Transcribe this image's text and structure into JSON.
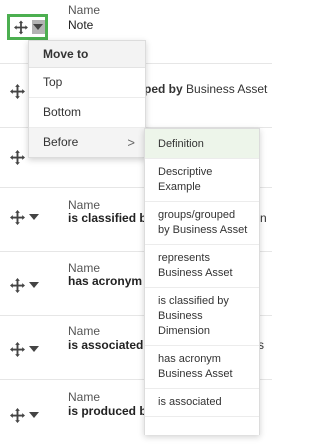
{
  "rows": [
    {
      "label": "Name",
      "value": "Note",
      "tail_plain": "",
      "tail_bold": ""
    },
    {
      "label": "",
      "value": "",
      "tail_pre": "ped by",
      "tail_post": "Business Asset"
    },
    {
      "label": "",
      "value": "",
      "tail": ""
    },
    {
      "label": "Name",
      "value": "is classified b",
      "tail": "n"
    },
    {
      "label": "Name",
      "value": "has acronym",
      "tail": ""
    },
    {
      "label": "Name",
      "value": "is associated",
      "tail": "s"
    },
    {
      "label": "Name",
      "value": "is produced b",
      "tail": ""
    }
  ],
  "menu": {
    "header": "Move to",
    "items": [
      {
        "label": "Top"
      },
      {
        "label": "Bottom"
      },
      {
        "label": "Before",
        "chevron": ">"
      }
    ]
  },
  "submenu": {
    "items": [
      "Definition",
      "Descriptive Example",
      "groups/grouped by Business Asset",
      "represents Business Asset",
      "is classified by Business Dimension",
      "has acronym Business Asset",
      "is associated"
    ]
  },
  "colors": {
    "active_border": "#4caf50",
    "submenu_highlight": "#edf5ea"
  }
}
